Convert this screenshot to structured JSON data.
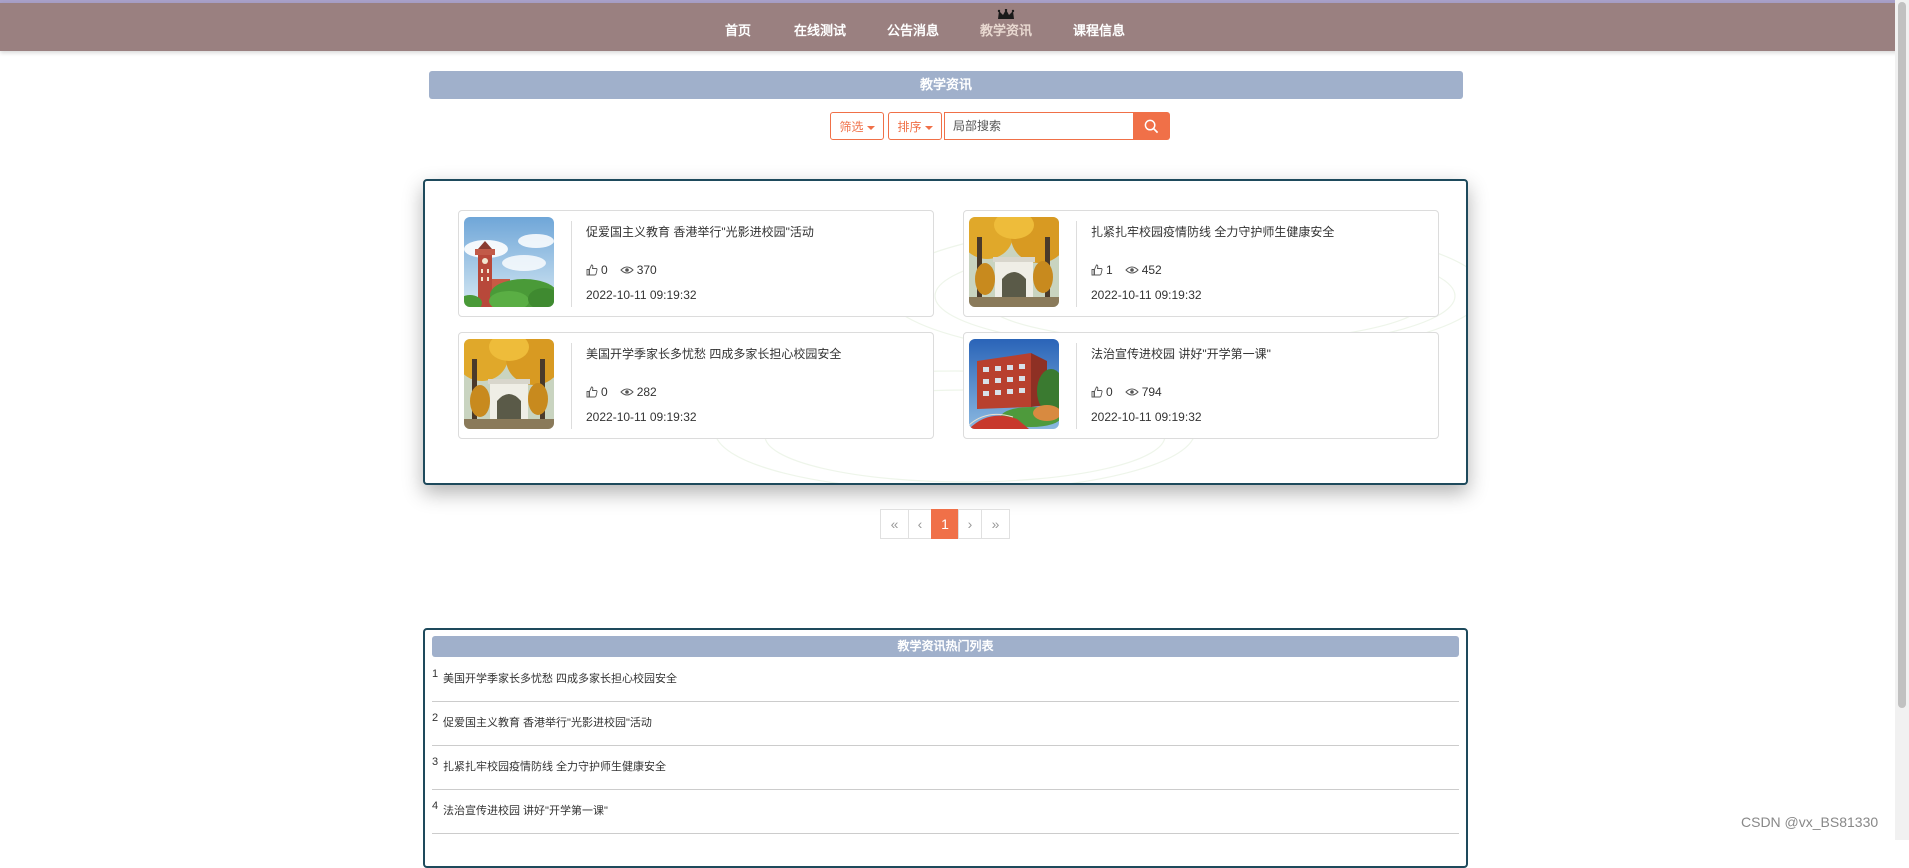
{
  "nav": {
    "items": [
      {
        "label": "首页",
        "active": false
      },
      {
        "label": "在线测试",
        "active": false
      },
      {
        "label": "公告消息",
        "active": false
      },
      {
        "label": "教学资讯",
        "active": true
      },
      {
        "label": "课程信息",
        "active": false
      }
    ]
  },
  "page_title": "教学资讯",
  "toolbar": {
    "filter_label": "筛选",
    "sort_label": "排序",
    "search_placeholder": "局部搜索"
  },
  "news": [
    {
      "title": "促爱国主义教育 香港举行\"光影进校园\"活动",
      "likes": "0",
      "views": "370",
      "date": "2022-10-11 09:19:32",
      "image": "tower-blue-sky"
    },
    {
      "title": "扎紧扎牢校园疫情防线 全力守护师生健康安全",
      "likes": "1",
      "views": "452",
      "date": "2022-10-11 09:19:32",
      "image": "gate-autumn-trees"
    },
    {
      "title": "美国开学季家长多忧愁 四成多家长担心校园安全",
      "likes": "0",
      "views": "282",
      "date": "2022-10-11 09:19:32",
      "image": "gate-autumn-trees"
    },
    {
      "title": "法治宣传进校园 讲好\"开学第一课\"",
      "likes": "0",
      "views": "794",
      "date": "2022-10-11 09:19:32",
      "image": "red-building-track"
    }
  ],
  "pagination": {
    "first": "«",
    "prev": "‹",
    "current": "1",
    "next": "›",
    "last": "»"
  },
  "hot": {
    "title": "教学资讯热门列表",
    "items": [
      {
        "num": "1",
        "text": "美国开学季家长多忧愁 四成多家长担心校园安全"
      },
      {
        "num": "2",
        "text": "促爱国主义教育 香港举行\"光影进校园\"活动"
      },
      {
        "num": "3",
        "text": "扎紧扎牢校园疫情防线 全力守护师生健康安全"
      },
      {
        "num": "4",
        "text": "法治宣传进校园 讲好\"开学第一课\""
      }
    ]
  },
  "watermark": "CSDN @vx_BS81330",
  "colors": {
    "nav": "#9a8080",
    "accent": "#f07048",
    "title_bar": "#a0b0cb",
    "panel_border": "#1e4a5c"
  }
}
